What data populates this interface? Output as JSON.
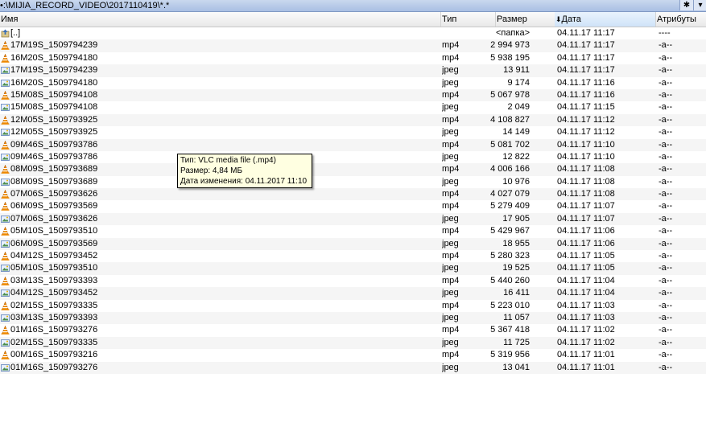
{
  "path_bar": {
    "path": "•:\\MIJIA_RECORD_VIDEO\\2017110419\\*.*",
    "star_button": "✱",
    "dropdown_button": "▾"
  },
  "columns": {
    "name": "Имя",
    "type": "Тип",
    "size": "Размер",
    "date": "Дата",
    "date_sort_indicator": "🠗",
    "attributes": "Атрибуты"
  },
  "rows": [
    {
      "name": "[..]",
      "type": "",
      "size": "<папка>",
      "date": "04.11.17 11:17",
      "attr": "----",
      "icon": "up-folder-icon"
    },
    {
      "name": "17M19S_1509794239",
      "type": "mp4",
      "size": "2 994 973",
      "date": "04.11.17 11:17",
      "attr": "-a--",
      "icon": "vlc-cone-icon"
    },
    {
      "name": "16M20S_1509794180",
      "type": "mp4",
      "size": "5 938 195",
      "date": "04.11.17 11:17",
      "attr": "-a--",
      "icon": "vlc-cone-icon"
    },
    {
      "name": "17M19S_1509794239",
      "type": "jpeg",
      "size": "13 911",
      "date": "04.11.17 11:17",
      "attr": "-a--",
      "icon": "image-icon"
    },
    {
      "name": "16M20S_1509794180",
      "type": "jpeg",
      "size": "9 174",
      "date": "04.11.17 11:16",
      "attr": "-a--",
      "icon": "image-icon"
    },
    {
      "name": "15M08S_1509794108",
      "type": "mp4",
      "size": "5 067 978",
      "date": "04.11.17 11:16",
      "attr": "-a--",
      "icon": "vlc-cone-icon"
    },
    {
      "name": "15M08S_1509794108",
      "type": "jpeg",
      "size": "2 049",
      "date": "04.11.17 11:15",
      "attr": "-a--",
      "icon": "image-icon"
    },
    {
      "name": "12M05S_1509793925",
      "type": "mp4",
      "size": "4 108 827",
      "date": "04.11.17 11:12",
      "attr": "-a--",
      "icon": "vlc-cone-icon"
    },
    {
      "name": "12M05S_1509793925",
      "type": "jpeg",
      "size": "14 149",
      "date": "04.11.17 11:12",
      "attr": "-a--",
      "icon": "image-icon"
    },
    {
      "name": "09M46S_1509793786",
      "type": "mp4",
      "size": "5 081 702",
      "date": "04.11.17 11:10",
      "attr": "-a--",
      "icon": "vlc-cone-icon"
    },
    {
      "name": "09M46S_1509793786",
      "type": "jpeg",
      "size": "12 822",
      "date": "04.11.17 11:10",
      "attr": "-a--",
      "icon": "image-icon"
    },
    {
      "name": "08M09S_1509793689",
      "type": "mp4",
      "size": "4 006 166",
      "date": "04.11.17 11:08",
      "attr": "-a--",
      "icon": "vlc-cone-icon"
    },
    {
      "name": "08M09S_1509793689",
      "type": "jpeg",
      "size": "10 976",
      "date": "04.11.17 11:08",
      "attr": "-a--",
      "icon": "image-icon"
    },
    {
      "name": "07M06S_1509793626",
      "type": "mp4",
      "size": "4 027 079",
      "date": "04.11.17 11:08",
      "attr": "-a--",
      "icon": "vlc-cone-icon"
    },
    {
      "name": "06M09S_1509793569",
      "type": "mp4",
      "size": "5 279 409",
      "date": "04.11.17 11:07",
      "attr": "-a--",
      "icon": "vlc-cone-icon"
    },
    {
      "name": "07M06S_1509793626",
      "type": "jpeg",
      "size": "17 905",
      "date": "04.11.17 11:07",
      "attr": "-a--",
      "icon": "image-icon"
    },
    {
      "name": "05M10S_1509793510",
      "type": "mp4",
      "size": "5 429 967",
      "date": "04.11.17 11:06",
      "attr": "-a--",
      "icon": "vlc-cone-icon"
    },
    {
      "name": "06M09S_1509793569",
      "type": "jpeg",
      "size": "18 955",
      "date": "04.11.17 11:06",
      "attr": "-a--",
      "icon": "image-icon"
    },
    {
      "name": "04M12S_1509793452",
      "type": "mp4",
      "size": "5 280 323",
      "date": "04.11.17 11:05",
      "attr": "-a--",
      "icon": "vlc-cone-icon"
    },
    {
      "name": "05M10S_1509793510",
      "type": "jpeg",
      "size": "19 525",
      "date": "04.11.17 11:05",
      "attr": "-a--",
      "icon": "image-icon"
    },
    {
      "name": "03M13S_1509793393",
      "type": "mp4",
      "size": "5 440 260",
      "date": "04.11.17 11:04",
      "attr": "-a--",
      "icon": "vlc-cone-icon"
    },
    {
      "name": "04M12S_1509793452",
      "type": "jpeg",
      "size": "16 411",
      "date": "04.11.17 11:04",
      "attr": "-a--",
      "icon": "image-icon"
    },
    {
      "name": "02M15S_1509793335",
      "type": "mp4",
      "size": "5 223 010",
      "date": "04.11.17 11:03",
      "attr": "-a--",
      "icon": "vlc-cone-icon"
    },
    {
      "name": "03M13S_1509793393",
      "type": "jpeg",
      "size": "11 057",
      "date": "04.11.17 11:03",
      "attr": "-a--",
      "icon": "image-icon"
    },
    {
      "name": "01M16S_1509793276",
      "type": "mp4",
      "size": "5 367 418",
      "date": "04.11.17 11:02",
      "attr": "-a--",
      "icon": "vlc-cone-icon"
    },
    {
      "name": "02M15S_1509793335",
      "type": "jpeg",
      "size": "11 725",
      "date": "04.11.17 11:02",
      "attr": "-a--",
      "icon": "image-icon"
    },
    {
      "name": "00M16S_1509793216",
      "type": "mp4",
      "size": "5 319 956",
      "date": "04.11.17 11:01",
      "attr": "-a--",
      "icon": "vlc-cone-icon"
    },
    {
      "name": "01M16S_1509793276",
      "type": "jpeg",
      "size": "13 041",
      "date": "04.11.17 11:01",
      "attr": "-a--",
      "icon": "image-icon"
    }
  ],
  "tooltip": {
    "type_line": "Тип: VLC media file (.mp4)",
    "size_line": "Размер: 4,84 МБ",
    "date_line": "Дата изменения: 04.11.2017 11:10"
  },
  "colors": {
    "vlc_orange": "#f08a00",
    "tooltip_bg": "#ffffe1",
    "path_bar_bg": "#b6c9e8"
  }
}
